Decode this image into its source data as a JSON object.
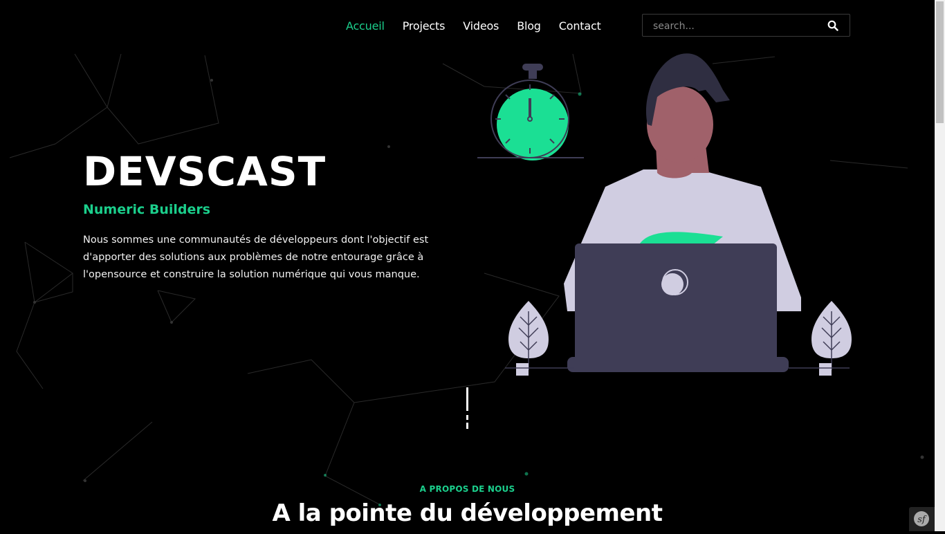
{
  "nav": {
    "items": [
      {
        "label": "Accueil",
        "active": true
      },
      {
        "label": "Projects",
        "active": false
      },
      {
        "label": "Videos",
        "active": false
      },
      {
        "label": "Blog",
        "active": false
      },
      {
        "label": "Contact",
        "active": false
      }
    ]
  },
  "search": {
    "placeholder": "search...",
    "icon": "search-icon"
  },
  "hero": {
    "title": "DEVSCAST",
    "subtitle": "Numeric Builders",
    "description": "Nous sommes une communautés de développeurs dont l'objectif est d'apporter des solutions aux problèmes de notre entourage grâce à l'opensource et construire la solution numérique qui vous manque."
  },
  "about": {
    "kicker": "A PROPOS DE NOUS",
    "title": "A la pointe du développement"
  },
  "colors": {
    "accent": "#1bcf8c",
    "background": "#000000",
    "laptop": "#3f3d56",
    "shirt": "#d0cde1",
    "skin": "#a0616a"
  },
  "icons": {
    "symfony_toolbar": "symfony-icon"
  }
}
